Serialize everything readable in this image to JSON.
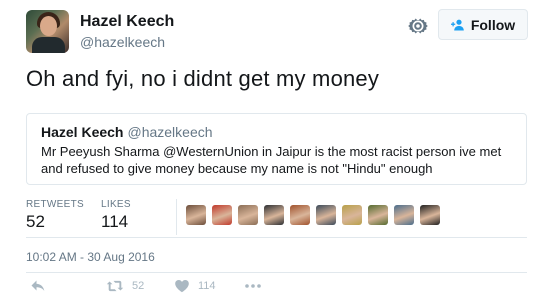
{
  "author": {
    "name": "Hazel Keech",
    "handle": "@hazelkeech"
  },
  "follow_button": {
    "label": "Follow"
  },
  "tweet": {
    "text": "Oh and fyi, no i didnt get my money"
  },
  "quoted_tweet": {
    "name": "Hazel Keech",
    "handle": "@hazelkeech",
    "text": "Mr Peeyush Sharma @WesternUnion in Jaipur is the most racist person ive met and refused to give money because my name is not \"Hindu\" enough"
  },
  "stats": {
    "retweets_label": "RETWEETS",
    "retweets_value": "52",
    "likes_label": "LIKES",
    "likes_value": "114"
  },
  "likers": [
    "#6b4d3a",
    "#c0392b",
    "#8a6d55",
    "#2c2f33",
    "#a0522d",
    "#3b4a5a",
    "#b8a04a",
    "#556b2f",
    "#4a6d8c",
    "#1f1f1f"
  ],
  "timestamp": "10:02 AM - 30 Aug 2016",
  "actions": {
    "retweet_count": "52",
    "like_count": "114"
  },
  "colors": {
    "accent": "#1da1f2",
    "muted": "#657786",
    "border": "#e1e8ed",
    "action_gray": "#aab8c2"
  }
}
